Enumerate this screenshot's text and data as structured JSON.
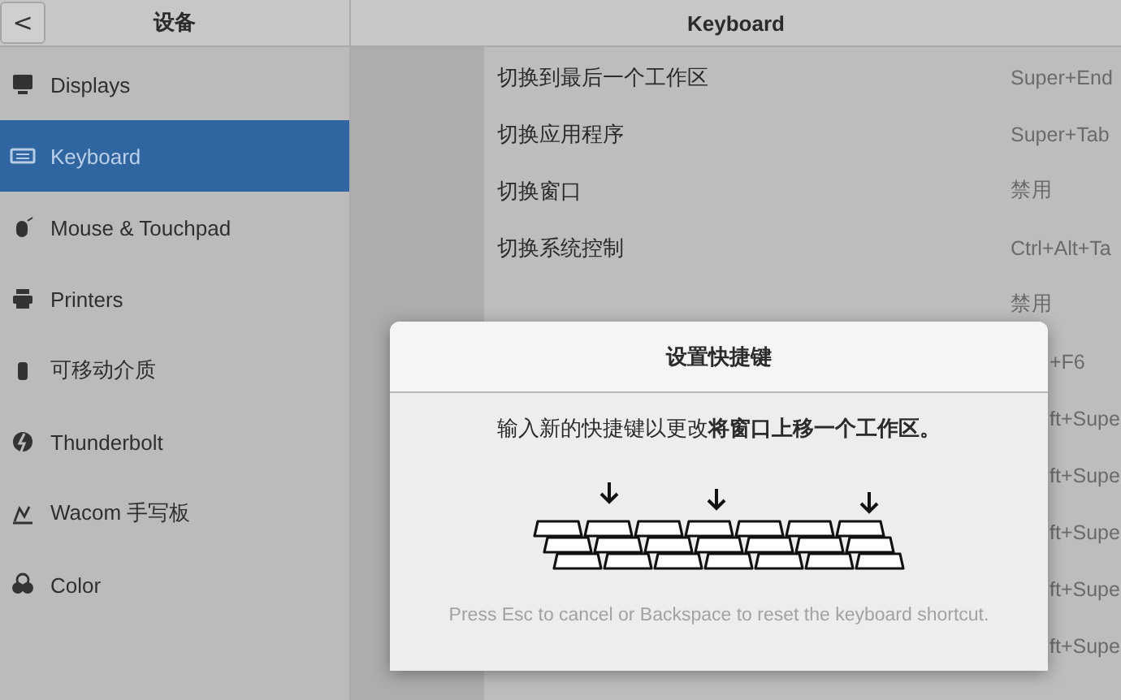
{
  "header": {
    "back_button": "<",
    "sidebar_title": "设备",
    "title": "Keyboard"
  },
  "sidebar": {
    "items": [
      {
        "label": "Displays",
        "selected": false
      },
      {
        "label": "Keyboard",
        "selected": true
      },
      {
        "label": "Mouse & Touchpad",
        "selected": false
      },
      {
        "label": "Printers",
        "selected": false
      },
      {
        "label": "可移动介质",
        "selected": false
      },
      {
        "label": "Thunderbolt",
        "selected": false
      },
      {
        "label": "Wacom 手写板",
        "selected": false
      },
      {
        "label": "Color",
        "selected": false
      }
    ]
  },
  "shortcuts": [
    {
      "kind": "full",
      "name": "切换到最后一个工作区",
      "shortcut": "Super+End"
    },
    {
      "kind": "full",
      "name": "切换应用程序",
      "shortcut": "Super+Tab"
    },
    {
      "kind": "full",
      "name": "切换窗口",
      "shortcut": "禁用"
    },
    {
      "kind": "full",
      "name": "切换系统控制",
      "shortcut": "Ctrl+Alt+Ta"
    },
    {
      "kind": "full",
      "shortcut": "禁用"
    },
    {
      "kind": "clipped",
      "shortcut": "+F6"
    },
    {
      "kind": "clipped",
      "shortcut": "ft+Supe"
    },
    {
      "kind": "clipped",
      "shortcut": "ft+Supe"
    },
    {
      "kind": "clipped",
      "shortcut": "ft+Supe"
    },
    {
      "kind": "clipped",
      "shortcut": "ft+Supe"
    },
    {
      "kind": "clipped",
      "shortcut": "ft+Supe"
    }
  ],
  "dialog": {
    "title": "设置快捷键",
    "message": "输入新的快捷键以更改**将窗口上移一个工作区。**",
    "hint": "Press Esc to cancel or Backspace to reset the keyboard shortcut."
  }
}
